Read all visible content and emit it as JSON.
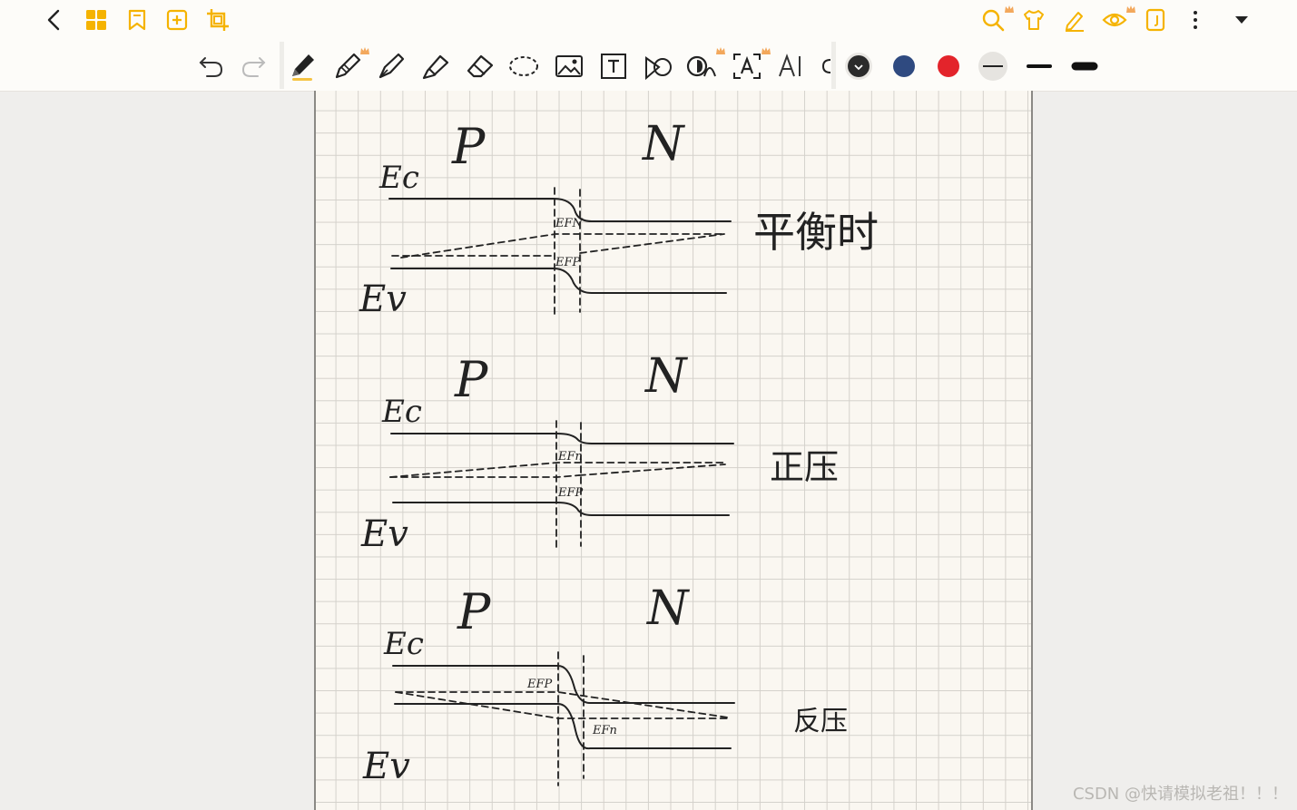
{
  "toolbar": {
    "nav_icons": [
      "back-icon",
      "grid-icon",
      "bookmark-icon",
      "add-page-icon",
      "crop-icon"
    ],
    "right_icons": [
      "search-icon",
      "shirt-icon",
      "highlight-pen-icon",
      "eye-icon",
      "page-template-icon",
      "more-icon",
      "dropdown-icon"
    ],
    "tools": [
      "undo-icon",
      "redo-icon",
      "pen-icon",
      "pencil-icon",
      "fountain-pen-icon",
      "highlighter-icon",
      "eraser-icon",
      "lasso-icon",
      "image-icon",
      "text-box-icon",
      "shape-icon",
      "recognize-icon",
      "ocr-icon",
      "ai-icon"
    ],
    "colors": {
      "black": "#2b2b2b",
      "blue": "#2f4a80",
      "red": "#e3242b",
      "accent": "#f5b301"
    }
  },
  "notes": {
    "diagram1": {
      "p": "P",
      "n": "N",
      "ec": "Ec",
      "ev": "Ev",
      "efn": "EFN",
      "efp": "EFP",
      "caption": "平衡时"
    },
    "diagram2": {
      "p": "P",
      "n": "N",
      "ec": "Ec",
      "ev": "Ev",
      "efn": "EFn",
      "efp": "EFP",
      "caption": "正压"
    },
    "diagram3": {
      "p": "P",
      "n": "N",
      "ec": "Ec",
      "ev": "Ev",
      "efn": "EFn",
      "efp": "EFP",
      "caption": "反压"
    }
  },
  "watermark": "CSDN @快请模拟老祖！！！"
}
